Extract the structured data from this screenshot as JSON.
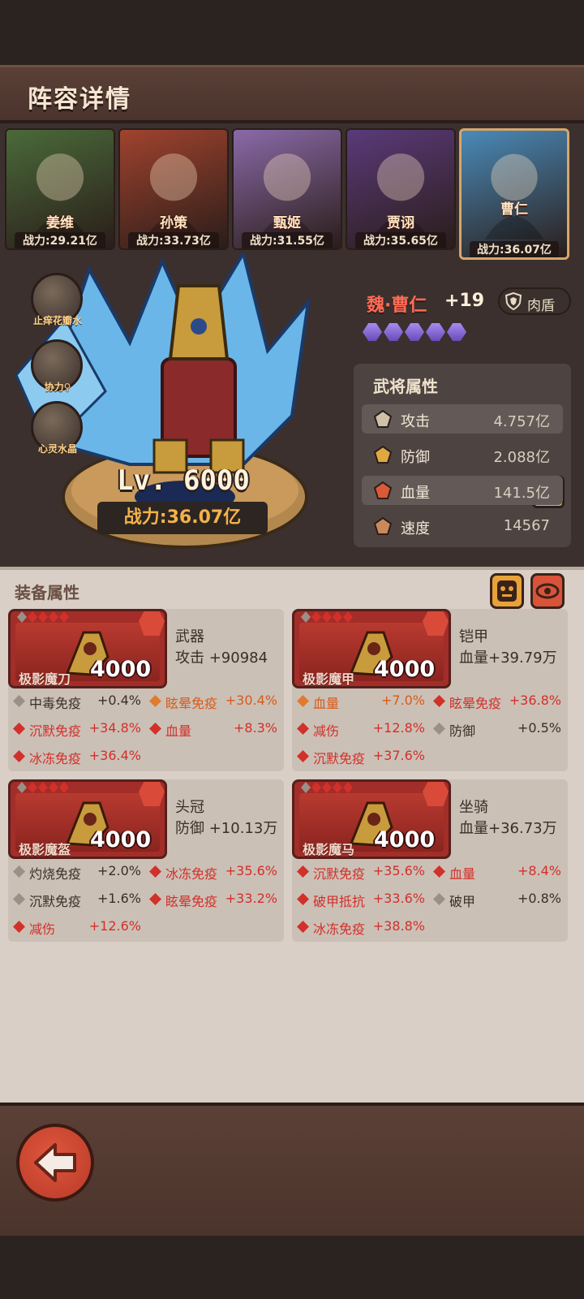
{
  "header": {
    "title": "阵容详情"
  },
  "lineup": [
    {
      "name": "姜维",
      "power": "战力:29.21亿",
      "color": "#4a6a3a"
    },
    {
      "name": "孙策",
      "power": "战力:33.73亿",
      "color": "#a0432e"
    },
    {
      "name": "甄姬",
      "power": "战力:31.55亿",
      "color": "#8a6aa8"
    },
    {
      "name": "贾诩",
      "power": "战力:35.65亿",
      "color": "#5a3a7a"
    },
    {
      "name": "曹仁",
      "power": "战力:36.07亿",
      "color": "#4a8ab8",
      "selected": true
    }
  ],
  "skills": [
    {
      "label": "止痒花瓣水",
      "icon": "bottle-icon"
    },
    {
      "label": "协力♀",
      "icon": "fish-icon"
    },
    {
      "label": "心灵水晶",
      "icon": "crab-icon"
    }
  ],
  "hero": {
    "name": "魏·曹仁",
    "star": "+19",
    "role": "肉盾",
    "level": "Lv. 6000",
    "power": "战力:36.07亿",
    "gem_count": 5
  },
  "attributes": {
    "title": "武将属性",
    "info": "i",
    "rows": [
      {
        "name": "攻击",
        "value": "4.757亿",
        "icon": "sword-icon"
      },
      {
        "name": "防御",
        "value": "2.088亿",
        "icon": "shield-icon"
      },
      {
        "name": "血量",
        "value": "141.5亿",
        "icon": "blood-icon"
      },
      {
        "name": "速度",
        "value": "14567",
        "icon": "boot-icon"
      }
    ]
  },
  "equipment": {
    "title": "装备属性",
    "items": [
      {
        "name": "极影魔刀",
        "level": "4000",
        "type": "武器",
        "main": "攻击 +90984",
        "subs": [
          {
            "name": "中毒免疫",
            "value": "+0.4%",
            "tone": "dark",
            "gem": "#9a9088"
          },
          {
            "name": "眩晕免疫",
            "value": "+30.4%",
            "tone": "orange",
            "gem": "#e07a30"
          },
          {
            "name": "沉默免疫",
            "value": "+34.8%",
            "tone": "red",
            "gem": "#d2302a"
          },
          {
            "name": "血量",
            "value": "+8.3%",
            "tone": "red",
            "gem": "#d2302a"
          },
          {
            "name": "冰冻免疫",
            "value": "+36.4%",
            "tone": "red",
            "gem": "#d2302a"
          }
        ]
      },
      {
        "name": "极影魔甲",
        "level": "4000",
        "type": "铠甲",
        "main": "血量+39.79万",
        "subs": [
          {
            "name": "血量",
            "value": "+7.0%",
            "tone": "orange",
            "gem": "#e07a30"
          },
          {
            "name": "眩晕免疫",
            "value": "+36.8%",
            "tone": "red",
            "gem": "#d2302a"
          },
          {
            "name": "减伤",
            "value": "+12.8%",
            "tone": "red",
            "gem": "#d2302a"
          },
          {
            "name": "防御",
            "value": "+0.5%",
            "tone": "dark",
            "gem": "#9a9088"
          },
          {
            "name": "沉默免疫",
            "value": "+37.6%",
            "tone": "red",
            "gem": "#d2302a"
          }
        ]
      },
      {
        "name": "极影魔盔",
        "level": "4000",
        "type": "头冠",
        "main": "防御 +10.13万",
        "subs": [
          {
            "name": "灼烧免疫",
            "value": "+2.0%",
            "tone": "dark",
            "gem": "#9a9088"
          },
          {
            "name": "冰冻免疫",
            "value": "+35.6%",
            "tone": "red",
            "gem": "#d2302a"
          },
          {
            "name": "沉默免疫",
            "value": "+1.6%",
            "tone": "dark",
            "gem": "#9a9088"
          },
          {
            "name": "眩晕免疫",
            "value": "+33.2%",
            "tone": "red",
            "gem": "#d2302a"
          },
          {
            "name": "减伤",
            "value": "+12.6%",
            "tone": "red",
            "gem": "#d2302a"
          }
        ]
      },
      {
        "name": "极影魔马",
        "level": "4000",
        "type": "坐骑",
        "main": "血量+36.73万",
        "subs": [
          {
            "name": "沉默免疫",
            "value": "+35.6%",
            "tone": "red",
            "gem": "#d2302a"
          },
          {
            "name": "血量",
            "value": "+8.4%",
            "tone": "red",
            "gem": "#d2302a"
          },
          {
            "name": "破甲抵抗",
            "value": "+33.6%",
            "tone": "red",
            "gem": "#d2302a"
          },
          {
            "name": "破甲",
            "value": "+0.8%",
            "tone": "dark",
            "gem": "#9a9088"
          },
          {
            "name": "冰冻免疫",
            "value": "+38.8%",
            "tone": "red",
            "gem": "#d2302a"
          }
        ]
      }
    ]
  },
  "colors": {
    "accent": "#f3b24a",
    "panel": "#d9cfc6",
    "danger": "#d2302a"
  }
}
